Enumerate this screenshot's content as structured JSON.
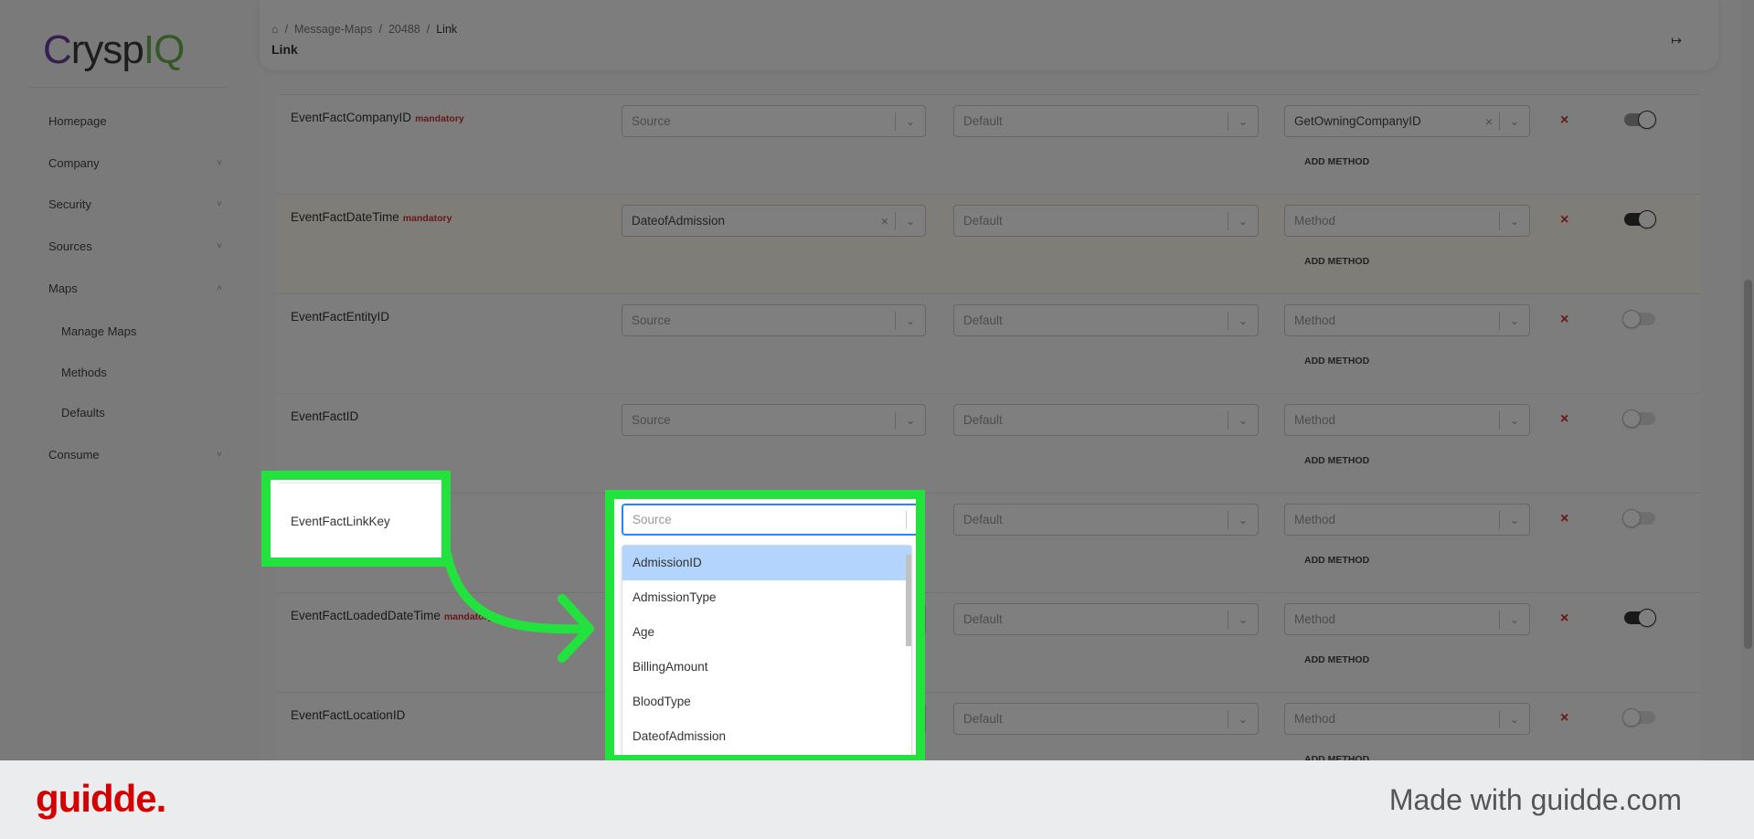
{
  "sidebar": {
    "logo": "CryspIQ",
    "items": [
      {
        "label": "Homepage",
        "chevron": false
      },
      {
        "label": "Company",
        "chevron": "down"
      },
      {
        "label": "Security",
        "chevron": "down"
      },
      {
        "label": "Sources",
        "chevron": "down"
      },
      {
        "label": "Maps",
        "chevron": "up"
      },
      {
        "label": "Manage Maps",
        "sub": true
      },
      {
        "label": "Methods",
        "sub": true
      },
      {
        "label": "Defaults",
        "sub": true
      },
      {
        "label": "Consume",
        "chevron": "down"
      }
    ]
  },
  "header": {
    "breadcrumb": [
      "Message-Maps",
      "20488",
      "Link"
    ],
    "title": "Link",
    "exit_icon": "logout-icon"
  },
  "common": {
    "add_method": "ADD METHOD",
    "mandatory": "mandatory",
    "source_ph": "Source",
    "default_ph": "Default",
    "method_ph": "Method"
  },
  "rows": [
    {
      "label": "EventFactCompanyID",
      "mandatory": true,
      "source": "",
      "default": "",
      "method": "GetOwningCompanyID",
      "toggle": "on-soft"
    },
    {
      "label": "EventFactDateTime",
      "mandatory": true,
      "source": "DateofAdmission",
      "default": "",
      "method": "",
      "toggle": "on",
      "highlighted": true
    },
    {
      "label": "EventFactEntityID",
      "mandatory": false,
      "source": "",
      "default": "",
      "method": "",
      "toggle": "off"
    },
    {
      "label": "EventFactID",
      "mandatory": false,
      "source": "",
      "default": "",
      "method": "",
      "toggle": "off"
    },
    {
      "label": "EventFactLinkKey",
      "mandatory": false,
      "source": "",
      "default": "",
      "method": "",
      "toggle": "off",
      "focus": true
    },
    {
      "label": "EventFactLoadedDateTime",
      "mandatory": true,
      "source": "",
      "default": "",
      "method": "",
      "toggle": "on"
    },
    {
      "label": "EventFactLocationID",
      "mandatory": false,
      "source": "",
      "default": "",
      "method": "",
      "toggle": "off"
    }
  ],
  "focus": {
    "label": "EventFactLinkKey",
    "placeholder": "Source",
    "options": [
      "AdmissionID",
      "AdmissionType",
      "Age",
      "BillingAmount",
      "BloodType",
      "DateofAdmission"
    ],
    "active_option": "AdmissionID"
  },
  "colors": {
    "highlight": "#22e33e",
    "accent": "#2684ff",
    "danger": "#d32f2f",
    "option_active": "#b3d4fc",
    "brand": "#d40000"
  },
  "footer": {
    "logo": "guidde.",
    "made_with": "Made with guidde.com"
  }
}
